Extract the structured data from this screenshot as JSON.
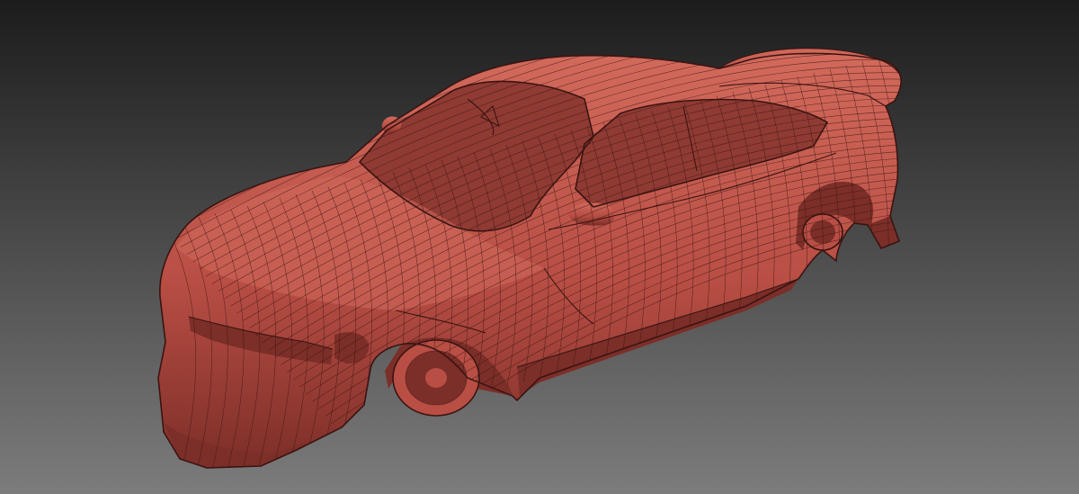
{
  "viewport": {
    "model_name": "",
    "background_top": "#1c1c1c",
    "background_bottom": "#7c7c7c",
    "model_color": "#b84e44",
    "model_shadow_color": "#7c2e28",
    "model_highlight_color": "#d26a5c",
    "wire_color": "#3a1412",
    "window_color": "#8f3a33"
  }
}
